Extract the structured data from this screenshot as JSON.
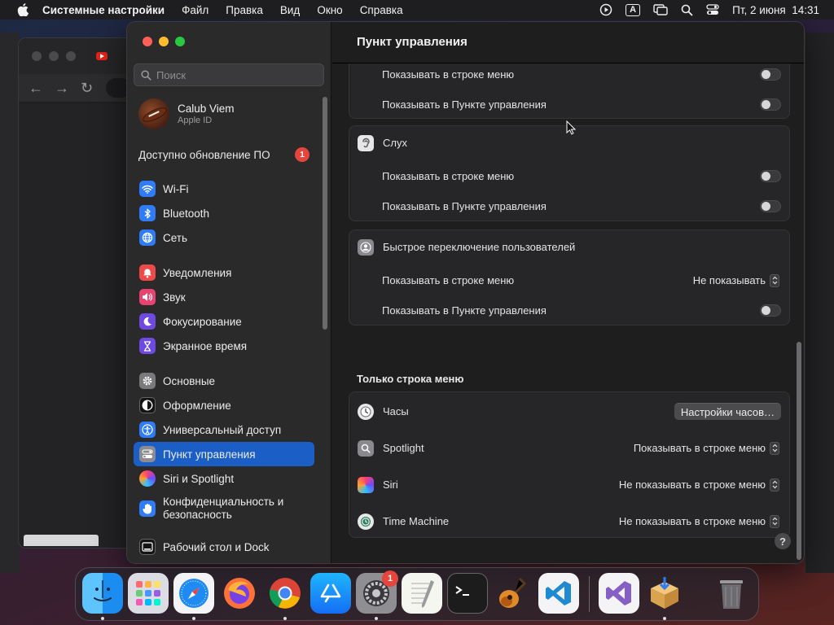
{
  "menubar": {
    "app_name": "Системные настройки",
    "menus": [
      "Файл",
      "Правка",
      "Вид",
      "Окно",
      "Справка"
    ],
    "keyboard_layout": "A",
    "datetime": "Пт, 2 июня  14:31"
  },
  "window": {
    "search_placeholder": "Поиск",
    "apple_id": {
      "name": "Calub Viem",
      "subtitle": "Apple ID"
    },
    "update": {
      "label": "Доступно обновление ПО",
      "badge": "1"
    },
    "sidebar": {
      "items": [
        {
          "label": "Wi-Fi",
          "icon": "wifi-icon"
        },
        {
          "label": "Bluetooth",
          "icon": "bluetooth-icon"
        },
        {
          "label": "Сеть",
          "icon": "globe-icon"
        },
        {
          "label": "Уведомления",
          "icon": "bell-icon"
        },
        {
          "label": "Звук",
          "icon": "speaker-icon"
        },
        {
          "label": "Фокусирование",
          "icon": "moon-icon"
        },
        {
          "label": "Экранное время",
          "icon": "hourglass-icon"
        },
        {
          "label": "Основные",
          "icon": "gear-icon"
        },
        {
          "label": "Оформление",
          "icon": "appearance-icon"
        },
        {
          "label": "Универсальный доступ",
          "icon": "accessibility-icon"
        },
        {
          "label": "Пункт управления",
          "icon": "control-center-icon",
          "selected": true
        },
        {
          "label": "Siri и Spotlight",
          "icon": "siri-icon"
        },
        {
          "label": "Конфиденциальность и безопасность",
          "icon": "hand-icon"
        },
        {
          "label": "Рабочий стол и Dock",
          "icon": "dock-icon"
        }
      ]
    },
    "main": {
      "title": "Пункт управления",
      "group_top": {
        "rows": [
          {
            "label": "Показывать в строке меню",
            "control": "toggle",
            "value": false
          },
          {
            "label": "Показывать в Пункте управления",
            "control": "toggle",
            "value": false
          }
        ]
      },
      "group_hearing": {
        "header": "Слух",
        "icon": "ear-icon",
        "rows": [
          {
            "label": "Показывать в строке меню",
            "control": "toggle",
            "value": false
          },
          {
            "label": "Показывать в Пункте управления",
            "control": "toggle",
            "value": false
          }
        ]
      },
      "group_user_switch": {
        "header": "Быстрое переключение пользователей",
        "icon": "user-icon",
        "rows": [
          {
            "label": "Показывать в строке меню",
            "control": "popup",
            "value": "Не показывать"
          },
          {
            "label": "Показывать в Пункте управления",
            "control": "toggle",
            "value": false
          }
        ]
      },
      "menubar_only": {
        "title": "Только строка меню",
        "rows": [
          {
            "label": "Часы",
            "icon": "clock-icon",
            "control": "button",
            "value": "Настройки часов…"
          },
          {
            "label": "Spotlight",
            "icon": "spotlight-icon",
            "control": "popup",
            "value": "Показывать в строке меню"
          },
          {
            "label": "Siri",
            "icon": "siri-icon",
            "control": "popup",
            "value": "Не показывать в строке меню"
          },
          {
            "label": "Time Machine",
            "icon": "time-machine-icon",
            "control": "popup",
            "value": "Не показывать в строке меню"
          }
        ]
      },
      "help": "?"
    }
  },
  "dock": {
    "apps": [
      {
        "name": "Finder",
        "icon": "finder-icon",
        "running": true
      },
      {
        "name": "Launchpad",
        "icon": "launchpad-icon",
        "running": false
      },
      {
        "name": "Safari",
        "icon": "safari-icon",
        "running": true
      },
      {
        "name": "Firefox",
        "icon": "firefox-icon",
        "running": false
      },
      {
        "name": "Chrome",
        "icon": "chrome-icon",
        "running": true
      },
      {
        "name": "App Store",
        "icon": "app-store-icon",
        "running": false
      },
      {
        "name": "Системные настройки",
        "icon": "system-settings-icon",
        "running": true,
        "badge": "1"
      },
      {
        "name": "TextEdit",
        "icon": "textedit-icon",
        "running": false
      },
      {
        "name": "Terminal",
        "icon": "terminal-icon",
        "running": false
      },
      {
        "name": "GarageBand",
        "icon": "garageband-icon",
        "running": false
      },
      {
        "name": "Visual Studio Code",
        "icon": "vscode-icon",
        "running": false
      },
      {
        "name": "Visual Studio",
        "icon": "visual-studio-icon",
        "running": false
      },
      {
        "name": "Installer",
        "icon": "installer-icon",
        "running": true
      },
      {
        "name": "Корзина",
        "icon": "trash-icon",
        "running": false
      }
    ]
  }
}
